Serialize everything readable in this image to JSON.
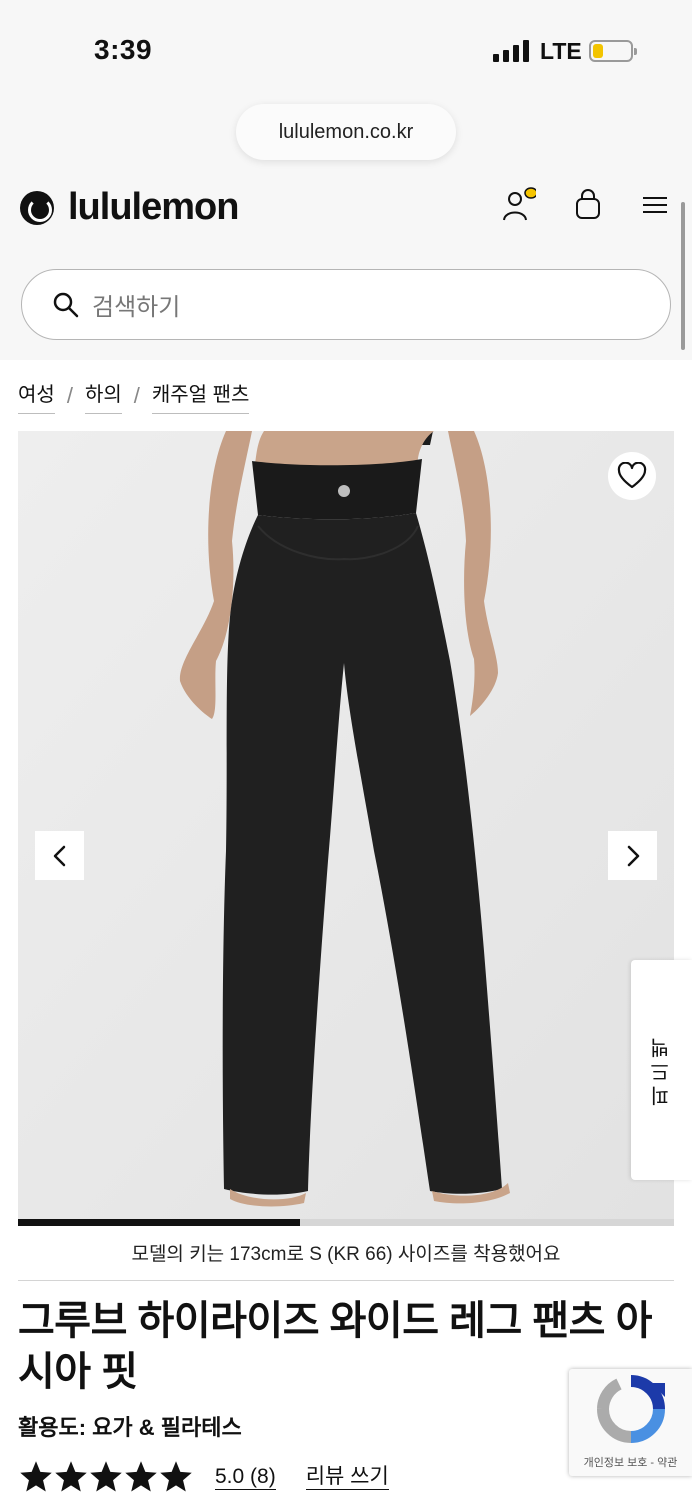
{
  "status_bar": {
    "time": "3:39",
    "network": "LTE",
    "battery_color": "#f2c400"
  },
  "browser": {
    "url": "lululemon.co.kr"
  },
  "header": {
    "brand": "lululemon",
    "notification_color": "#f5c400"
  },
  "search": {
    "placeholder": "검색하기"
  },
  "breadcrumb": [
    {
      "label": "여성"
    },
    {
      "label": "하의"
    },
    {
      "label": "캐주얼 팬츠"
    }
  ],
  "gallery": {
    "progress_fraction": 0.43
  },
  "feedback_tab": {
    "label": "피드백"
  },
  "product": {
    "model_note": "모델의 키는 173cm로 S (KR 66) 사이즈를 착용했어요",
    "title": "그루브 하이라이즈 와이드 레그 팬츠 아시아 핏",
    "activity": "활용도: 요가 & 필라테스",
    "rating": {
      "stars": 5,
      "score_text": "5.0 (8)"
    },
    "review_link": "리뷰 쓰기"
  },
  "recaptcha": {
    "label": "개인정보 보호 - 약관"
  }
}
